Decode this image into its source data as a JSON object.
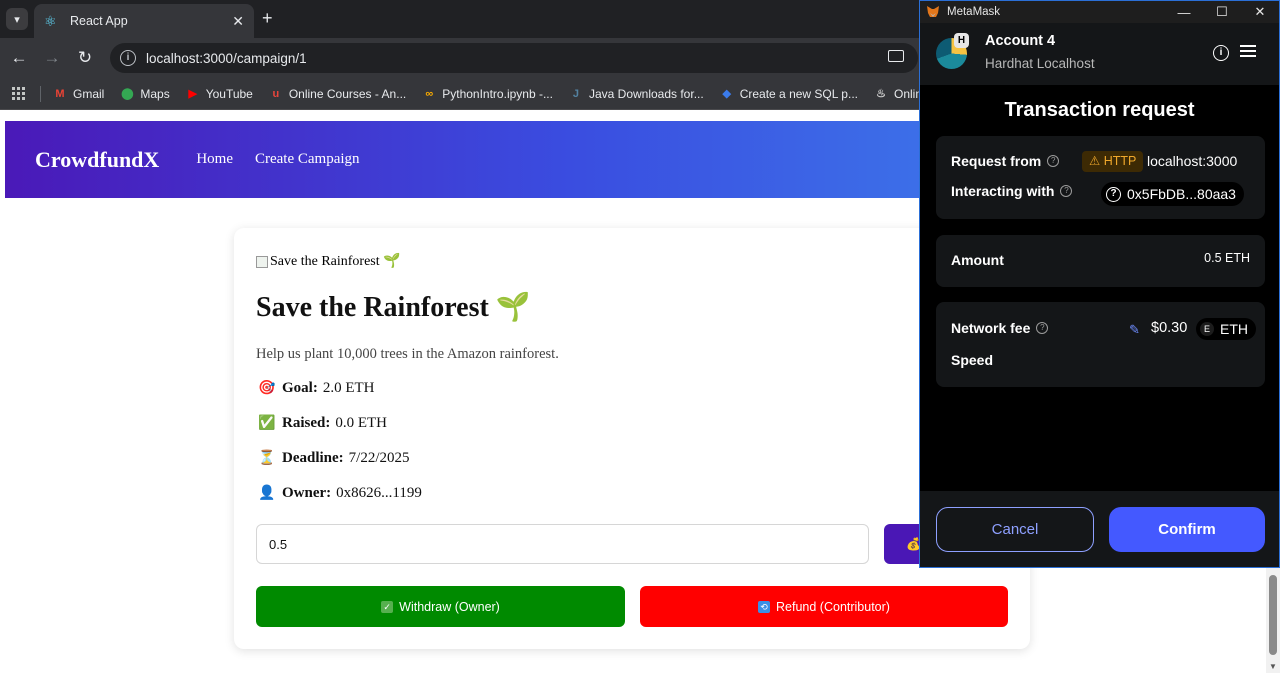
{
  "browser": {
    "tab_title": "React App",
    "url": "localhost:3000/campaign/1",
    "bookmarks": [
      {
        "label": "Gmail",
        "icon": "gmail-icon",
        "color": "#ea4335",
        "glyph": "M"
      },
      {
        "label": "Maps",
        "icon": "maps-icon",
        "color": "#34a853",
        "glyph": "⬤"
      },
      {
        "label": "YouTube",
        "icon": "youtube-icon",
        "color": "#ff0000",
        "glyph": "▶"
      },
      {
        "label": "Online Courses - An...",
        "icon": "udemy-icon",
        "color": "#e8453c",
        "glyph": "u"
      },
      {
        "label": "PythonIntro.ipynb -...",
        "icon": "colab-icon",
        "color": "#f9ab00",
        "glyph": "∞"
      },
      {
        "label": "Java Downloads for...",
        "icon": "java-icon",
        "color": "#5382a1",
        "glyph": "J"
      },
      {
        "label": "Create a new SQL p...",
        "icon": "sql-icon",
        "color": "#3b7bea",
        "glyph": "◆"
      },
      {
        "label": "Online Java",
        "icon": "online-java-icon",
        "color": "#cccccc",
        "glyph": "♨"
      }
    ]
  },
  "app": {
    "brand": "CrowdfundX",
    "nav": [
      "Home",
      "Create Campaign"
    ],
    "campaign": {
      "image_alt": "Save the Rainforest 🌱",
      "title": "Save the Rainforest 🌱",
      "description": "Help us plant 10,000 trees in the Amazon rainforest.",
      "stats": [
        {
          "emoji": "🎯",
          "label": "Goal:",
          "value": "2.0 ETH"
        },
        {
          "emoji": "✅",
          "label": "Raised:",
          "value": "0.0 ETH"
        },
        {
          "emoji": "⏳",
          "label": "Deadline:",
          "value": "7/22/2025"
        },
        {
          "emoji": "👤",
          "label": "Owner:",
          "value": "0x8626...1199"
        }
      ],
      "amount_value": "0.5",
      "contribute_icon": "💰",
      "withdraw_label": "Withdraw (Owner)",
      "refund_label": "Refund (Contributor)"
    }
  },
  "metamask": {
    "window_title": "MetaMask",
    "account_badge": "H",
    "account_name": "Account 4",
    "network": "Hardhat Localhost",
    "heading": "Transaction request",
    "request_from_label": "Request from",
    "http_tag": "HTTP",
    "request_host": "localhost:3000",
    "interacting_label": "Interacting with",
    "contract_address": "0x5FbDB...80aa3",
    "amount_label": "Amount",
    "amount_value": "0.5 ETH",
    "network_fee_label": "Network fee",
    "fee_value": "$0.30",
    "fee_token_glyph": "E",
    "fee_token": "ETH",
    "speed_label": "Speed",
    "cancel_label": "Cancel",
    "confirm_label": "Confirm",
    "colors": {
      "accent": "#4459ff",
      "warning": "#f0a82b",
      "panel": "#141618"
    }
  }
}
